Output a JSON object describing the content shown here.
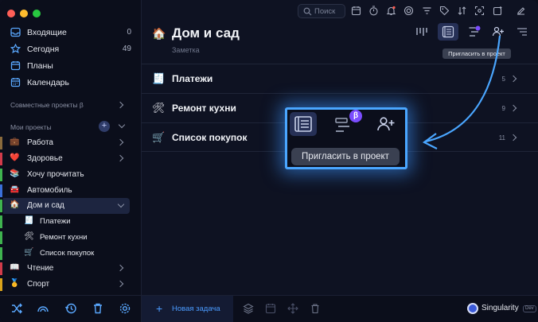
{
  "sidebar": {
    "top_items": [
      {
        "label": "Входящие",
        "count": "0",
        "icon": "inbox-icon"
      },
      {
        "label": "Сегодня",
        "count": "49",
        "icon": "star-icon"
      },
      {
        "label": "Планы",
        "count": "",
        "icon": "plans-icon"
      },
      {
        "label": "Календарь",
        "count": "",
        "icon": "calendar-icon"
      }
    ],
    "shared_title": "Совместные проекты β",
    "my_projects_title": "Мои проекты",
    "projects": [
      {
        "label": "Работа",
        "emoji": "💼",
        "bar_color": "#8a6a3c"
      },
      {
        "label": "Здоровье",
        "emoji": "❤️",
        "bar_color": "#d23b4a"
      },
      {
        "label": "Хочу прочитать",
        "emoji": "📚",
        "bar_color": "#3fb34f"
      },
      {
        "label": "Автомобиль",
        "emoji": "🚘",
        "bar_color": "#3a6fd8"
      },
      {
        "label": "Дом и сад",
        "emoji": "🏠",
        "bar_color": "#3fb34f"
      },
      {
        "label": "Чтение",
        "emoji": "📖",
        "bar_color": "#d23b4a"
      },
      {
        "label": "Спорт",
        "emoji": "🥇",
        "bar_color": "#d9a21b"
      }
    ],
    "subprojects": [
      {
        "label": "Платежи",
        "emoji": "🧾"
      },
      {
        "label": "Ремонт кухни",
        "emoji": "🛠"
      },
      {
        "label": "Список покупок",
        "emoji": "🛒"
      }
    ]
  },
  "toolbar": {
    "search_placeholder": "Поиск"
  },
  "header": {
    "emoji": "🏠",
    "title": "Дом и сад",
    "subtitle": "Заметка",
    "tooltip": "Пригласить в проект"
  },
  "tasks": [
    {
      "emoji": "🧾",
      "label": "Платежи",
      "count": "5"
    },
    {
      "emoji": "🛠",
      "label": "Ремонт кухни",
      "count": "9"
    },
    {
      "emoji": "🛒",
      "label": "Список покупок",
      "count": "11"
    }
  ],
  "zoom": {
    "beta": "β",
    "tooltip": "Пригласить в проект"
  },
  "bottom": {
    "new_task": "Новая задача",
    "brand": "Singularity",
    "brand_badge": "Dev"
  },
  "colors": {
    "accent": "#4a9bff",
    "active_project_bar": "#3fb34f",
    "beta_badge": "#7b4dff",
    "highlight_border": "#4aa6ff"
  }
}
